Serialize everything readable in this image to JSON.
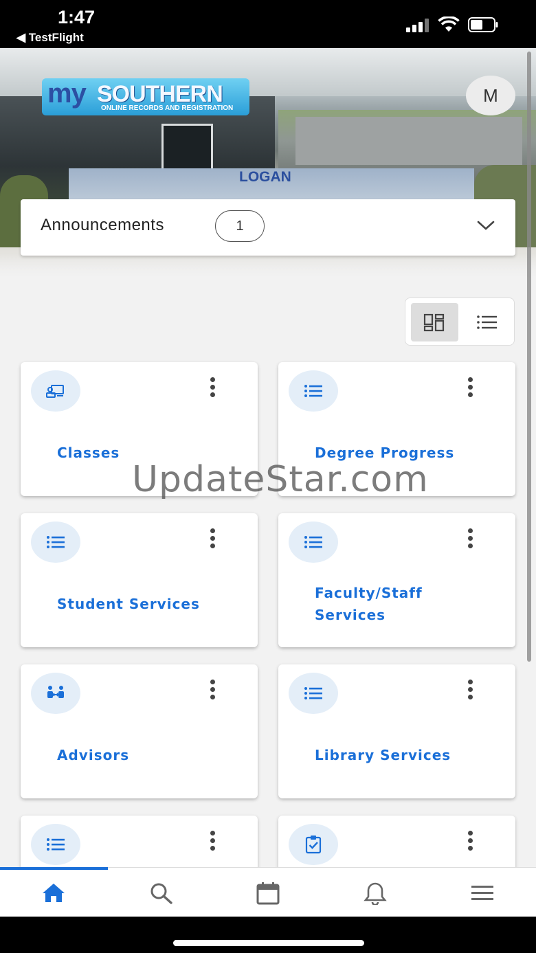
{
  "status_bar": {
    "time": "1:47",
    "back_app": "◀ TestFlight"
  },
  "header": {
    "logo": {
      "my": "my",
      "name": "SOUTHERN",
      "subtitle": "ONLINE RECORDS AND REGISTRATION"
    },
    "campus": "LOGAN",
    "avatar_initial": "M"
  },
  "announcements": {
    "label": "Announcements",
    "count": "1"
  },
  "view_toggle": {
    "active": "grid"
  },
  "cards": [
    {
      "title": "Classes",
      "icon": "classroom-icon"
    },
    {
      "title": "Degree Progress",
      "icon": "list-icon"
    },
    {
      "title": "Student Services",
      "icon": "list-icon"
    },
    {
      "title": "Faculty/Staff Services",
      "icon": "list-icon"
    },
    {
      "title": "Advisors",
      "icon": "advisors-icon"
    },
    {
      "title": "Library Services",
      "icon": "list-icon"
    },
    {
      "title": "",
      "icon": "list-icon"
    },
    {
      "title": "",
      "icon": "clipboard-check-icon"
    }
  ],
  "watermark": "UpdateStar.com",
  "bottom_nav": [
    {
      "name": "home",
      "icon": "home-icon",
      "active": true
    },
    {
      "name": "search",
      "icon": "search-icon",
      "active": false
    },
    {
      "name": "calendar",
      "icon": "calendar-icon",
      "active": false
    },
    {
      "name": "notifications",
      "icon": "bell-icon",
      "active": false
    },
    {
      "name": "menu",
      "icon": "hamburger-icon",
      "active": false
    }
  ],
  "colors": {
    "accent": "#1a6fd8",
    "icon_bg": "#e4eef8",
    "background": "#f2f2f2"
  }
}
